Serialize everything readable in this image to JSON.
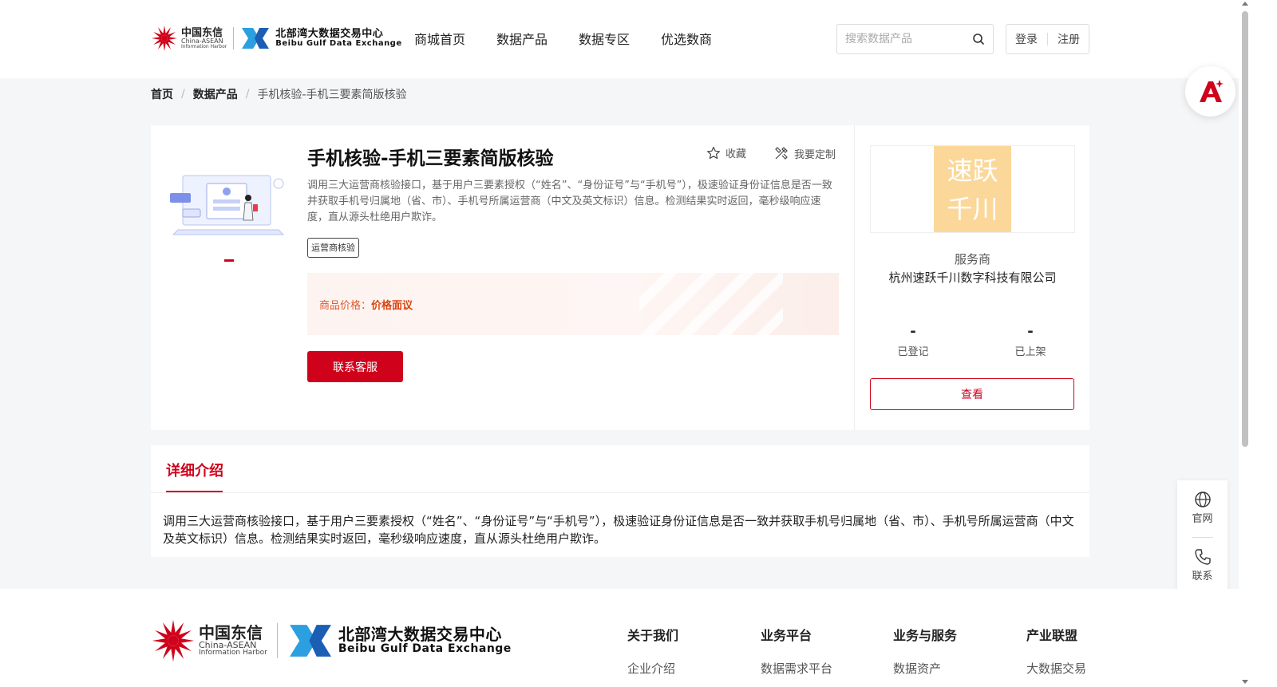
{
  "header": {
    "logo_cd": {
      "cn": "中国东信",
      "en1": "China-ASEAN",
      "en2": "Information Harbor"
    },
    "logo_bb": {
      "cn": "北部湾大数据交易中心",
      "en": "Beibu Gulf Data Exchange"
    },
    "nav": [
      "商城首页",
      "数据产品",
      "数据专区",
      "优选数商"
    ],
    "search_placeholder": "搜索数据产品",
    "login": "登录",
    "register": "注册"
  },
  "breadcrumb": {
    "home": "首页",
    "section": "数据产品",
    "current": "手机核验-手机三要素简版核验"
  },
  "product": {
    "title": "手机核验-手机三要素简版核验",
    "favorite": "收藏",
    "customize": "我要定制",
    "description": "调用三大运营商核验接口，基于用户三要素授权（“姓名”、“身份证号”与“手机号”），极速验证身份证信息是否一致并获取手机号归属地（省、市）、手机号所属运营商（中文及英文标识）信息。检测结果实时返回，毫秒级响应速度，直从源头杜绝用户欺诈。",
    "tag": "运营商核验",
    "price_label": "商品价格：",
    "price_value": "价格面议",
    "contact_button": "联系客服"
  },
  "provider": {
    "logo_line1": "速跃",
    "logo_line2": "千川",
    "label": "服务商",
    "name": "杭州速跃千川数字科技有限公司",
    "registered_value": "-",
    "registered_label": "已登记",
    "listed_value": "-",
    "listed_label": "已上架",
    "view_button": "查看"
  },
  "detail": {
    "tab": "详细介绍",
    "text": "调用三大运营商核验接口，基于用户三要素授权（“姓名”、“身份证号”与“手机号”），极速验证身份证信息是否一致并获取手机号归属地（省、市）、手机号所属运营商（中文及英文标识）信息。检测结果实时返回，毫秒级响应速度，直从源头杜绝用户欺诈。"
  },
  "side_float": {
    "website": "官网",
    "contact": "联系"
  },
  "footer": {
    "columns": [
      {
        "title": "关于我们",
        "item": "企业介绍"
      },
      {
        "title": "业务平台",
        "item": "数据需求平台"
      },
      {
        "title": "业务与服务",
        "item": "数据资产"
      },
      {
        "title": "产业联盟",
        "item": "大数据交易"
      }
    ]
  },
  "colors": {
    "brand_red": "#d0021b",
    "price_orange": "#d94511",
    "provider_logo_bg": "#fbd89a"
  }
}
